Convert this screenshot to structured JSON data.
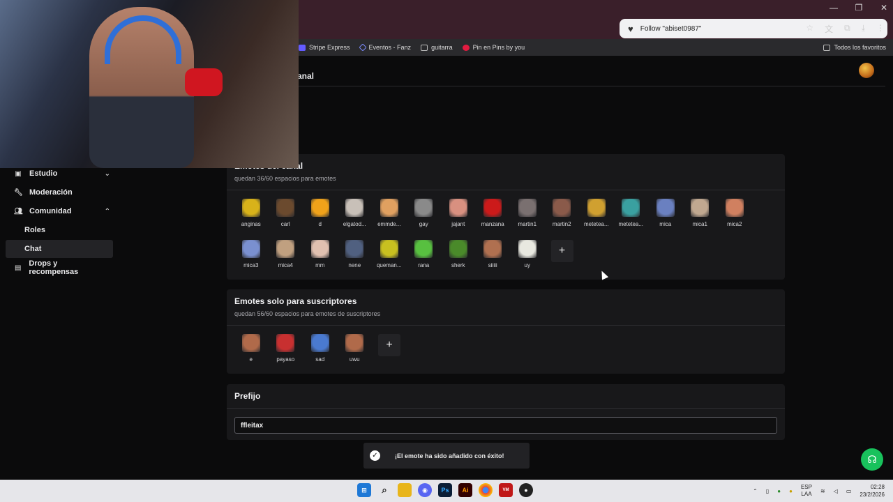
{
  "browser": {
    "follow_popup": "Follow \"abiset0987\"",
    "bookmarks": [
      "Stripe Express",
      "Eventos - Fanz",
      "guitarra",
      "Pin en Pins by you"
    ],
    "all_favorites": "Todos los favoritos"
  },
  "page": {
    "heading_visible": "anal"
  },
  "sidebar": {
    "items": [
      {
        "label": "Estudio",
        "icon": "studio-icon",
        "chevron": "down"
      },
      {
        "label": "Moderación",
        "icon": "wrench-icon"
      },
      {
        "label": "Comunidad",
        "icon": "community-icon",
        "chevron": "up"
      },
      {
        "label": "Roles"
      },
      {
        "label": "Chat",
        "active": true
      },
      {
        "label": "Drops y recompensas",
        "icon": "drops-icon"
      }
    ]
  },
  "channel_emotes": {
    "title": "Emotes del canal",
    "subtitle": "quedan 36/60 espacios para emotes",
    "emotes": [
      {
        "name": "anginas",
        "color": "#d8b21a"
      },
      {
        "name": "carl",
        "color": "#6b4a2e"
      },
      {
        "name": "d",
        "color": "#f0a21a"
      },
      {
        "name": "elgatod...",
        "color": "#c8c0b8"
      },
      {
        "name": "emmde...",
        "color": "#e0a060"
      },
      {
        "name": "gay",
        "color": "#8a8a8a"
      },
      {
        "name": "jajant",
        "color": "#d89080"
      },
      {
        "name": "manzana",
        "color": "#cc1a1a"
      },
      {
        "name": "martin1",
        "color": "#7a7070"
      },
      {
        "name": "martin2",
        "color": "#8a5a4a"
      },
      {
        "name": "metetea...",
        "color": "#d0a030"
      },
      {
        "name": "metetea...",
        "color": "#3aa0a0"
      },
      {
        "name": "mica",
        "color": "#6a80c0"
      },
      {
        "name": "mica1",
        "color": "#c0a890"
      },
      {
        "name": "mica2",
        "color": "#d08060"
      },
      {
        "name": "mica3",
        "color": "#7a90d0"
      },
      {
        "name": "mica4",
        "color": "#c0a080"
      },
      {
        "name": "mm",
        "color": "#e0c0b0"
      },
      {
        "name": "nene",
        "color": "#506080"
      },
      {
        "name": "queman...",
        "color": "#c8c020"
      },
      {
        "name": "rana",
        "color": "#58c040"
      },
      {
        "name": "sherk",
        "color": "#4a8a2a"
      },
      {
        "name": "siiiii",
        "color": "#b07050"
      },
      {
        "name": "uy",
        "color": "#e8e8e0"
      }
    ]
  },
  "sub_emotes": {
    "title": "Emotes solo para suscriptores",
    "subtitle": "quedan 56/60 espacios para emotes de suscriptores",
    "emotes": [
      {
        "name": "e",
        "color": "#b06a4a"
      },
      {
        "name": "payaso",
        "color": "#c83030"
      },
      {
        "name": "sad",
        "color": "#4a7ad0"
      },
      {
        "name": "uwu",
        "color": "#b06a4a"
      }
    ]
  },
  "prefix": {
    "title": "Prefijo",
    "value": "ffleitax"
  },
  "toast": {
    "message": "¡El emote ha sido añadido con éxito!"
  },
  "taskbar": {
    "lang_top": "ESP",
    "lang_bottom": "LAA",
    "time": "02:28",
    "date": "23/2/2026"
  }
}
